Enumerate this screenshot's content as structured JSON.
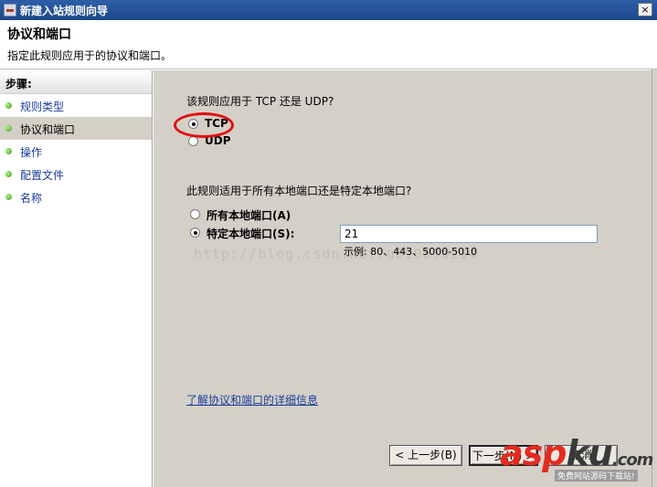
{
  "window": {
    "title": "新建入站规则向导",
    "close_label": "×"
  },
  "header": {
    "title": "协议和端口",
    "subtitle": "指定此规则应用于的协议和端口。"
  },
  "sidebar": {
    "header": "步骤:",
    "items": [
      {
        "label": "规则类型"
      },
      {
        "label": "协议和端口"
      },
      {
        "label": "操作"
      },
      {
        "label": "配置文件"
      },
      {
        "label": "名称"
      }
    ],
    "active_index": 1
  },
  "main": {
    "protocol_question": "该规则应用于 TCP 还是 UDP?",
    "protocol_options": [
      {
        "label": "TCP",
        "checked": true
      },
      {
        "label": "UDP",
        "checked": false
      }
    ],
    "port_question": "此规则适用于所有本地端口还是特定本地端口?",
    "port_options": [
      {
        "label": "所有本地端口(A)",
        "checked": false
      },
      {
        "label": "特定本地端口(S):",
        "checked": true
      }
    ],
    "port_value": "21",
    "port_example": "示例: 80、443、5000-5010",
    "watermark": "http://blog.csdn.net/u010870214",
    "learn_more_link": "了解协议和端口的详细信息"
  },
  "buttons": {
    "back": "< 上一步(B)",
    "next": "下一步(N) >",
    "cancel": "取消"
  },
  "logo": {
    "a": "a",
    "s": "s",
    "p": "p",
    "ku": "ku",
    "com": ".com",
    "tagline": "免费网站源码下载站!"
  },
  "colors": {
    "title_bar": "#1c4789",
    "highlight": "#e01010",
    "link": "#1a3d9a",
    "step_dot": "#3a9c18"
  }
}
